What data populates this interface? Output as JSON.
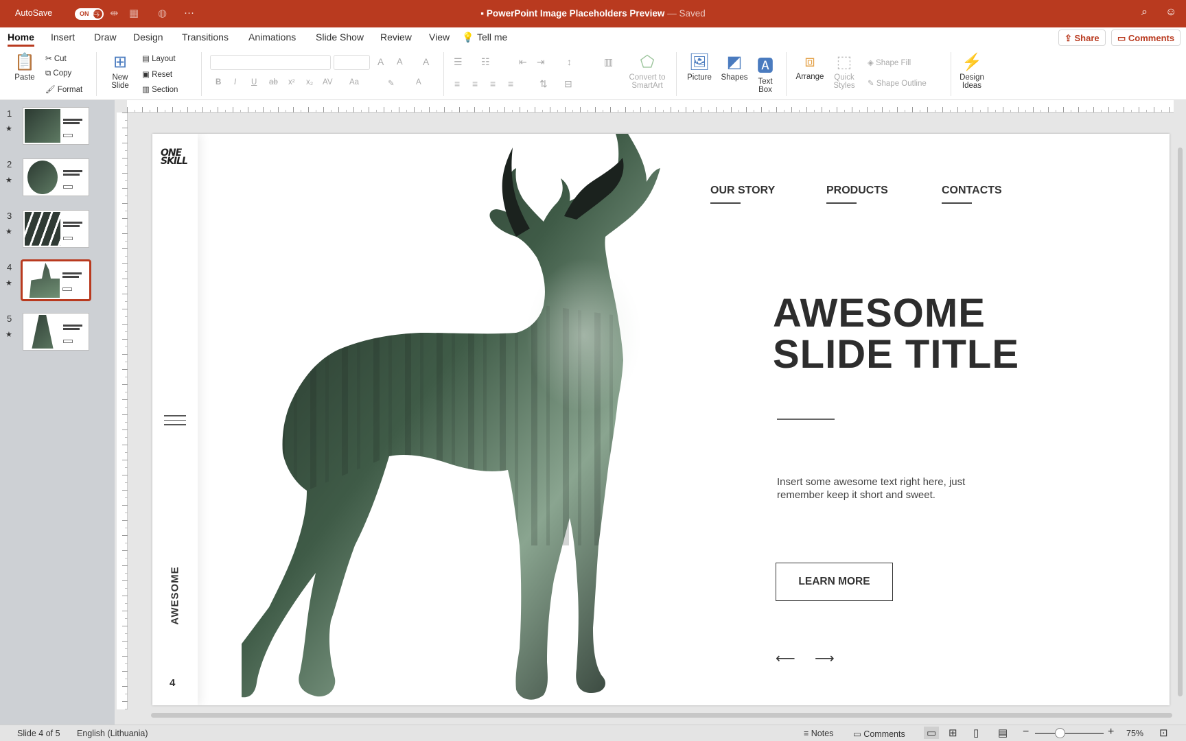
{
  "titlebar": {
    "autosave_label": "AutoSave",
    "autosave_state": "ON",
    "doc_title": "PowerPoint Image Placeholders Preview",
    "saved_status": "— Saved"
  },
  "tabs": [
    "Home",
    "Insert",
    "Draw",
    "Design",
    "Transitions",
    "Animations",
    "Slide Show",
    "Review",
    "View",
    "Tell me"
  ],
  "header_buttons": {
    "share": "Share",
    "comments": "Comments"
  },
  "ribbon": {
    "paste": "Paste",
    "cut": "Cut",
    "copy": "Copy",
    "format": "Format",
    "new_slide_1": "New",
    "new_slide_2": "Slide",
    "layout": "Layout",
    "reset": "Reset",
    "section": "Section",
    "convert_1": "Convert to",
    "convert_2": "SmartArt",
    "picture": "Picture",
    "shapes": "Shapes",
    "textbox_1": "Text",
    "textbox_2": "Box",
    "arrange": "Arrange",
    "quick_1": "Quick",
    "quick_2": "Styles",
    "shape_fill": "Shape Fill",
    "shape_outline": "Shape Outline",
    "design_1": "Design",
    "design_2": "Ideas"
  },
  "thumbnails": [
    {
      "num": "1",
      "mark": "★"
    },
    {
      "num": "2",
      "mark": "★"
    },
    {
      "num": "3",
      "mark": "★"
    },
    {
      "num": "4",
      "mark": "★"
    },
    {
      "num": "5",
      "mark": "★"
    }
  ],
  "slide": {
    "logo_line1": "ONE",
    "logo_line2": "SKILL",
    "nav": [
      "OUR STORY",
      "PRODUCTS",
      "CONTACTS"
    ],
    "title_line1": "AWESOME",
    "title_line2": "SLIDE TITLE",
    "body": "Insert some awesome text right here, just remember keep it short and sweet.",
    "button": "LEARN MORE",
    "vertical_label": "AWESOME",
    "page_number": "4",
    "arrow_left": "⟵",
    "arrow_right": "⟶"
  },
  "statusbar": {
    "slide_info": "Slide 4 of 5",
    "language": "English (Lithuania)",
    "notes": "Notes",
    "comments": "Comments",
    "zoom": "75%"
  },
  "colors": {
    "accent": "#b93a1f"
  }
}
